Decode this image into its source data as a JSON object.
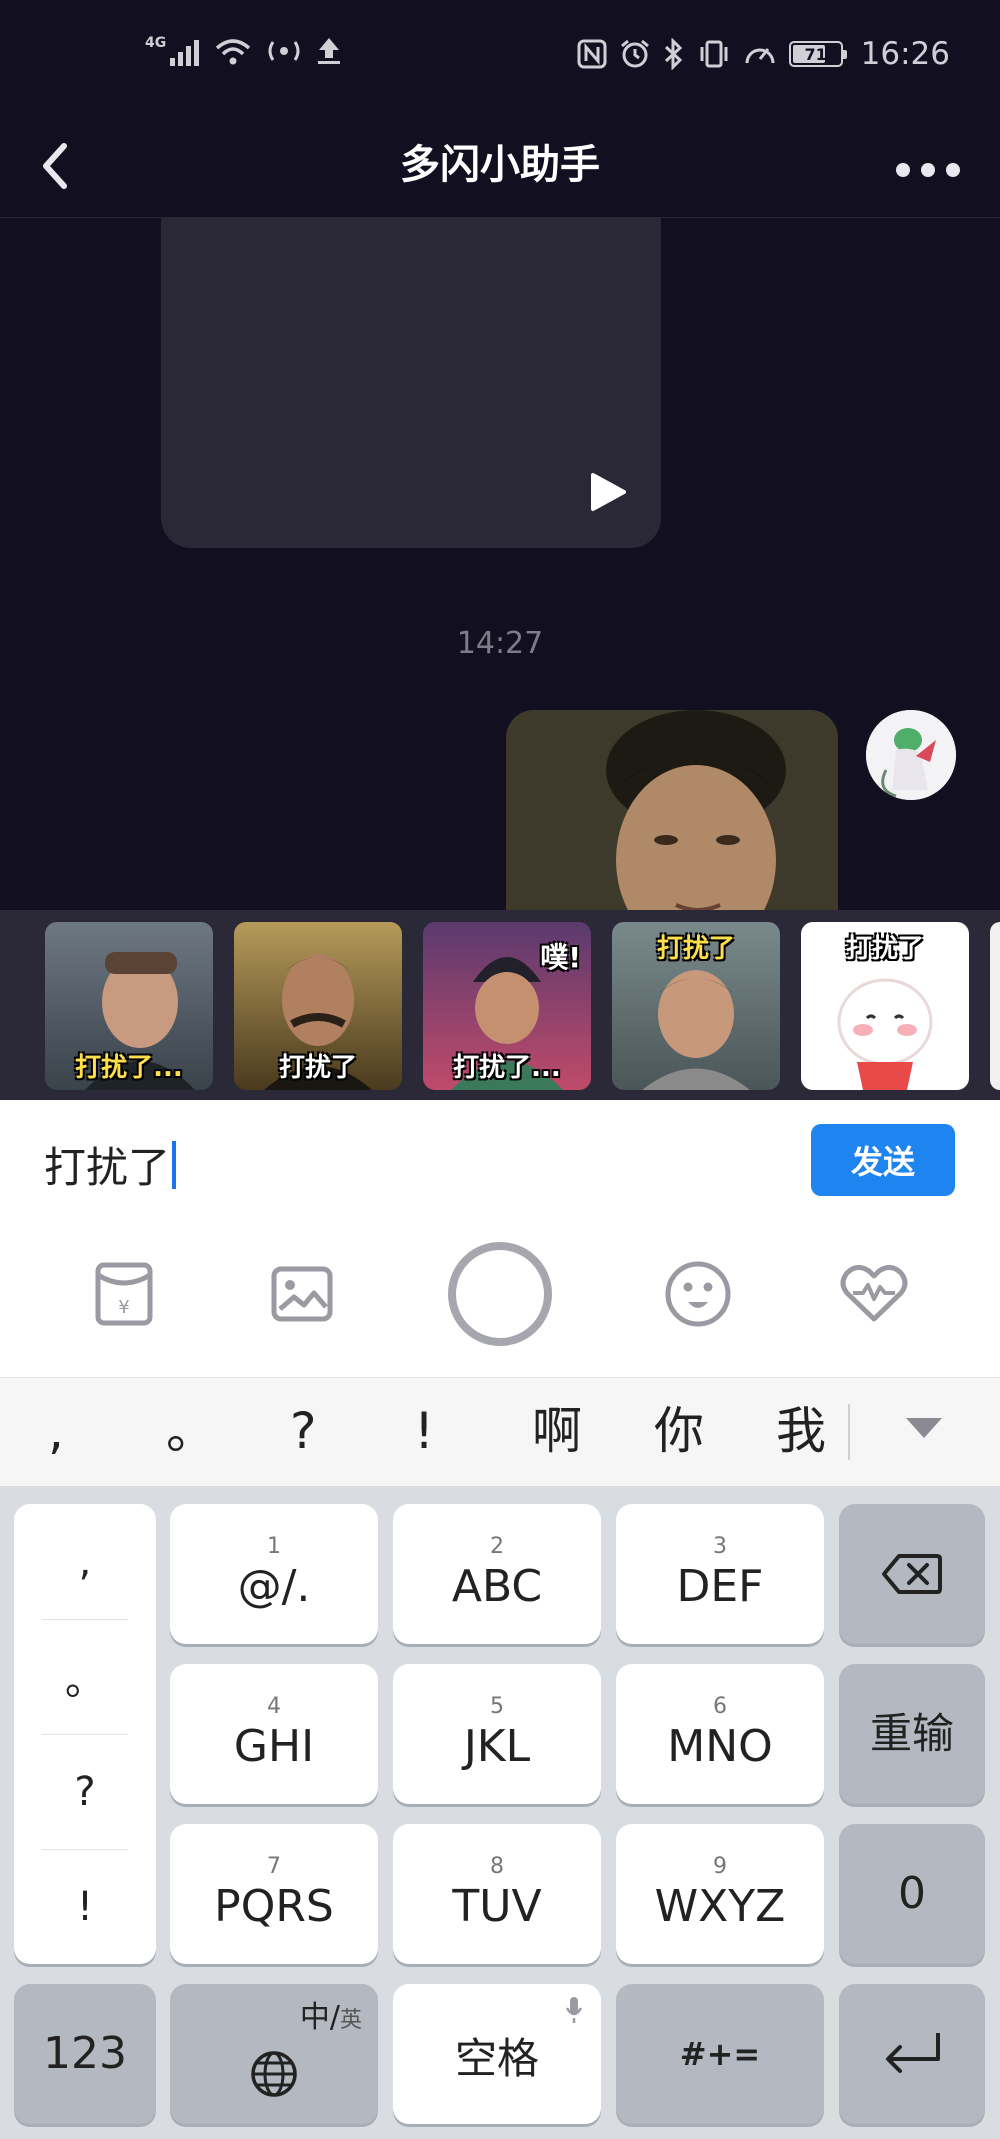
{
  "status_bar": {
    "network": "4G",
    "battery": "71",
    "time": "16:26",
    "battery_level": 0.71
  },
  "header": {
    "title": "多闪小助手"
  },
  "chat": {
    "timestamp": "14:27"
  },
  "stickers": [
    {
      "caption": "打扰了..."
    },
    {
      "caption": "打扰了"
    },
    {
      "caption": "打扰了...",
      "extra": "噗!"
    },
    {
      "caption": "打扰了"
    },
    {
      "caption": "打扰了"
    }
  ],
  "input": {
    "value": "打扰了",
    "send_label": "发送"
  },
  "toolbar": {
    "icons": [
      "red-packet-icon",
      "image-icon",
      "record-icon",
      "emoji-icon",
      "heart-icon"
    ]
  },
  "candidates": [
    ",",
    "。",
    "?",
    "!",
    "啊",
    "你",
    "我"
  ],
  "keyboard": {
    "punctuation": [
      ",",
      "。",
      "?",
      "!"
    ],
    "keys": [
      {
        "num": "1",
        "label": "@/."
      },
      {
        "num": "2",
        "label": "ABC"
      },
      {
        "num": "3",
        "label": "DEF"
      },
      {
        "num": "4",
        "label": "GHI"
      },
      {
        "num": "5",
        "label": "JKL"
      },
      {
        "num": "6",
        "label": "MNO"
      },
      {
        "num": "7",
        "label": "PQRS"
      },
      {
        "num": "8",
        "label": "TUV"
      },
      {
        "num": "9",
        "label": "WXYZ"
      }
    ],
    "retype": "重输",
    "zero": "0",
    "num_key": "123",
    "lang_cn": "中/",
    "lang_en": "英",
    "space": "空格",
    "symbols": "#+="
  },
  "colors": {
    "background": "#121020",
    "accent": "#1e84f0",
    "sticker_strip": "#2b2937"
  }
}
